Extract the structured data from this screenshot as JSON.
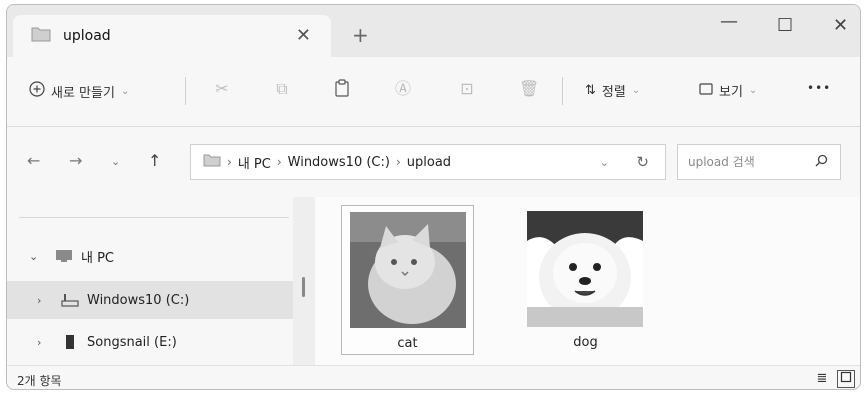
{
  "tab": {
    "title": "upload",
    "close": "✕"
  },
  "window_controls": {
    "minimize": "—",
    "maximize": "☐",
    "close": "✕",
    "new_tab": "+"
  },
  "toolbar": {
    "new_label": "새로 만들기",
    "sort_label": "정렬",
    "view_label": "보기",
    "more_label": "•••"
  },
  "address": {
    "crumbs": [
      "내 PC",
      "Windows10 (C:)",
      "upload"
    ],
    "separator": "›"
  },
  "search": {
    "placeholder": "upload 검색"
  },
  "nav_tree": {
    "items": [
      {
        "label": "내 PC",
        "icon": "pc-icon",
        "expanded": true
      },
      {
        "label": "Windows10 (C:)",
        "icon": "drive-icon",
        "selected": true
      },
      {
        "label": "Songsnail (E:)",
        "icon": "usb-drive-icon"
      }
    ]
  },
  "files": [
    {
      "name": "cat",
      "thumbnail": "white-cat-photo",
      "selected": true
    },
    {
      "name": "dog",
      "thumbnail": "white-pomeranian-photo",
      "selected": false
    }
  ],
  "status": {
    "count": "2개 항목"
  },
  "colors": {
    "window_bg": "#f7f7f7",
    "tabbar_bg": "#e9e9e9",
    "selection": "#e2e2e2"
  }
}
